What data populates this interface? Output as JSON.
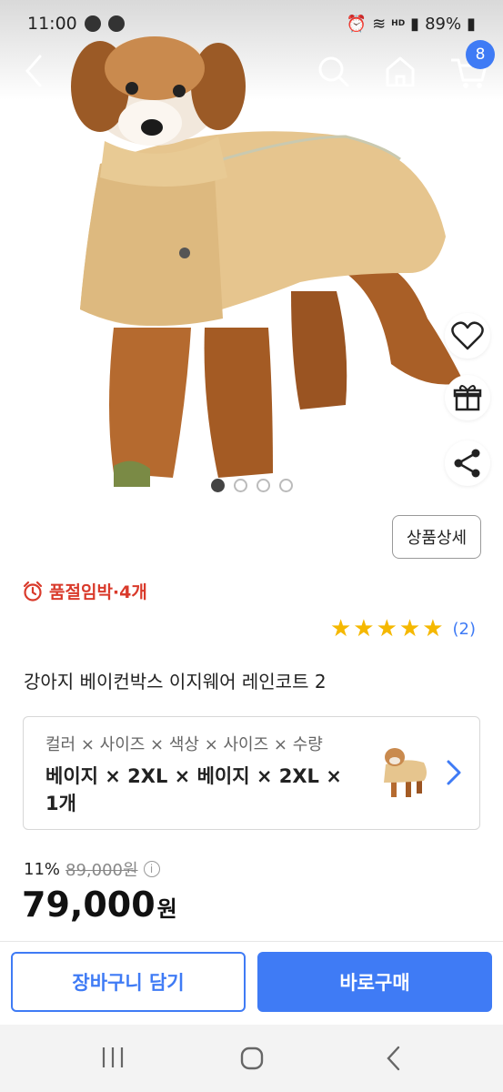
{
  "status_bar": {
    "time": "11:00",
    "battery": "89%",
    "hd_label": "HD"
  },
  "nav": {
    "cart_count": "8",
    "icons": [
      "back-icon",
      "search-icon",
      "home-icon",
      "cart-icon"
    ]
  },
  "side_actions": [
    "heart-icon",
    "gift-icon",
    "share-icon"
  ],
  "carousel": {
    "total": 4,
    "active": 1
  },
  "detail_button": "상품상세",
  "stock_text": "품절임박·4개",
  "rating": {
    "stars": 5,
    "count": "(2)"
  },
  "product_title": "강아지 베이컨박스 이지웨어 레인코트 2",
  "option": {
    "label": "컬러 × 사이즈 × 색상 × 사이즈 × 수량",
    "value": "베이지 × 2XL × 베이지 × 2XL × 1개"
  },
  "pricing": {
    "discount_rate": "11%",
    "original_price": "89,000원",
    "price": "79,000",
    "currency": "원"
  },
  "actions": {
    "add_to_cart": "장바구니 담기",
    "buy_now": "바로구매"
  },
  "colors": {
    "accent": "#3f7bf5",
    "stock_red": "#d93a2b",
    "star": "#f5b800",
    "coat": "#e6c58e",
    "fur": "#b8692b"
  }
}
